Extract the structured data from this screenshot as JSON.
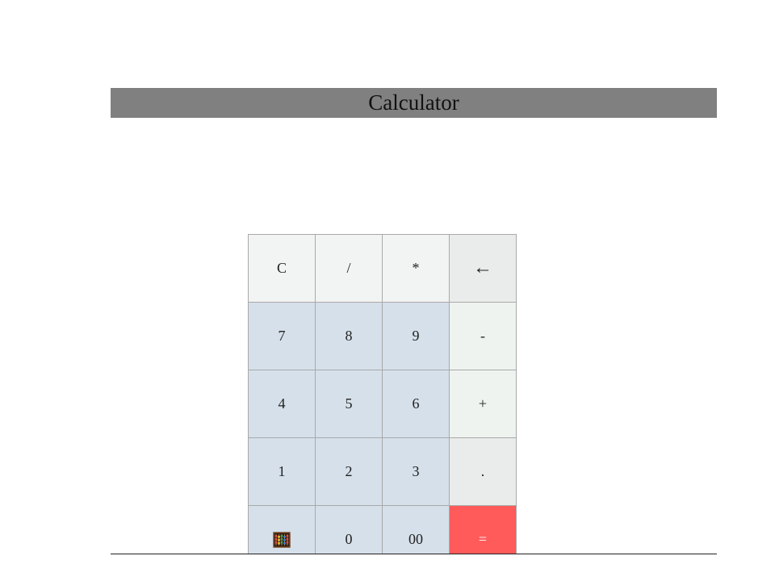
{
  "app": {
    "title": "Calculator"
  },
  "keypad": {
    "rows": [
      [
        {
          "label": "C",
          "name": "clear-button",
          "kind": "func"
        },
        {
          "label": "/",
          "name": "divide-button",
          "kind": "func"
        },
        {
          "label": "*",
          "name": "multiply-button",
          "kind": "func"
        },
        {
          "label": "←",
          "name": "backspace-button",
          "kind": "back"
        }
      ],
      [
        {
          "label": "7",
          "name": "digit-7-button",
          "kind": "num"
        },
        {
          "label": "8",
          "name": "digit-8-button",
          "kind": "num"
        },
        {
          "label": "9",
          "name": "digit-9-button",
          "kind": "num"
        },
        {
          "label": "-",
          "name": "subtract-button",
          "kind": "op"
        }
      ],
      [
        {
          "label": "4",
          "name": "digit-4-button",
          "kind": "num"
        },
        {
          "label": "5",
          "name": "digit-5-button",
          "kind": "num"
        },
        {
          "label": "6",
          "name": "digit-6-button",
          "kind": "num"
        },
        {
          "label": "+",
          "name": "add-button",
          "kind": "op"
        }
      ],
      [
        {
          "label": "1",
          "name": "digit-1-button",
          "kind": "num"
        },
        {
          "label": "2",
          "name": "digit-2-button",
          "kind": "num"
        },
        {
          "label": "3",
          "name": "digit-3-button",
          "kind": "num"
        },
        {
          "label": ".",
          "name": "decimal-button",
          "kind": "dot"
        }
      ],
      [
        {
          "label": "",
          "name": "abacus-button",
          "kind": "num",
          "icon": "abacus-icon"
        },
        {
          "label": "0",
          "name": "digit-0-button",
          "kind": "num"
        },
        {
          "label": "00",
          "name": "double-zero-button",
          "kind": "num"
        },
        {
          "label": "=",
          "name": "equals-button",
          "kind": "equals"
        }
      ]
    ]
  },
  "colors": {
    "titlebar": "#808080",
    "number_key": "#d5e0ea",
    "function_key": "#f2f4f3",
    "equals_key": "#ff5b5b"
  }
}
